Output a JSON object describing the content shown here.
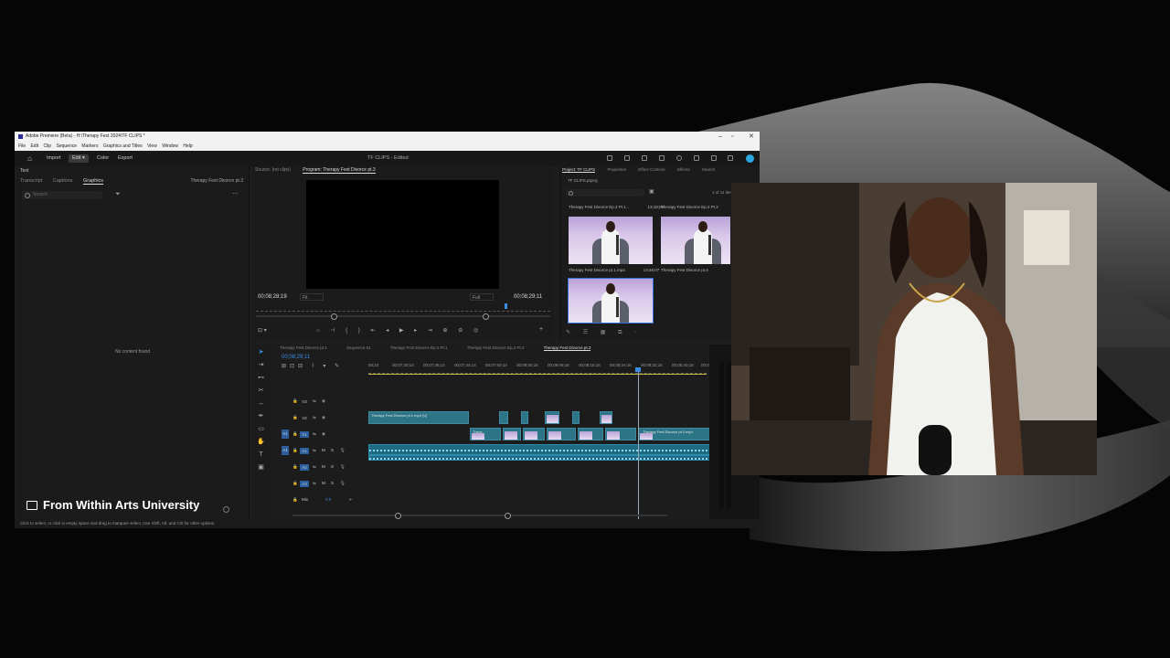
{
  "window": {
    "title": "Adobe Premiere (Beta) - H:\\Therapy Fest 2024\\TF CLIPS *",
    "controls": {
      "minimize": "–",
      "maximize": "▫",
      "close": "✕"
    }
  },
  "menu": [
    "File",
    "Edit",
    "Clip",
    "Sequence",
    "Markers",
    "Graphics and Titles",
    "View",
    "Window",
    "Help"
  ],
  "workspace": {
    "home_icon": "home-icon",
    "import": "Import",
    "edit": "Edit",
    "color": "Color",
    "export": "Export",
    "center_title": "TF CLIPS - Edited"
  },
  "text_panel": {
    "header": "Text",
    "tabs": [
      "Transcript",
      "Captions",
      "Graphics"
    ],
    "active_tab": "Graphics",
    "sequence": "Therapy Fest Divorce pt.3",
    "search_placeholder": "Search",
    "empty_message": "No content found"
  },
  "monitor": {
    "tabs": [
      "Source: (no clips)",
      "Program: Therapy Fest Divorce pt.3"
    ],
    "timecode_left": "00;08;28;19",
    "fit": "Fit",
    "quality": "Full",
    "timecode_right": "00;08;29;11",
    "controls": "⌂ ⊣ { } ⇤ ◂ ▶ ▸ ⇥ ⊕ ⊖ ◎",
    "add": "+"
  },
  "project": {
    "tabs": [
      "Project: TF CLIPS",
      "Properties",
      "Effect Controls",
      "Effects",
      "Search"
    ],
    "path": "TF CLIPS.prproj",
    "count": "1 of 11 items",
    "items": [
      {
        "name": "Therapy Fest Divorce Ep.2 Pt.1...",
        "dur": "13;18;05"
      },
      {
        "name": "Therapy Fest Divorce Ep.2 Pt.2",
        "dur": "1"
      },
      {
        "name": "Therapy Fest Divorce pt.1.mp4",
        "dur": "13;46;07"
      },
      {
        "name": "Therapy Fest Divorce pt.4",
        "dur": ""
      }
    ],
    "bottom_icons": "✎ ☰ ▦ ⧉ ◦"
  },
  "timeline": {
    "tabs": [
      "Therapy Fest Divorce pt.1",
      "Sequence 01",
      "Therapy Fest Divorce Ep.2 Pt.1",
      "Therapy Fest Divorce Ep.2 Pt.2",
      "Therapy Fest Divorce pt.3"
    ],
    "timecode": "00;08;29;11",
    "ruler": [
      "00;24",
      "00;07;20;14",
      "00;07;36;14",
      "00;07;44;14",
      "00;07;52;14",
      "00;08;00;16",
      "00;08;08;16",
      "00;08;16;16",
      "00;08;24;16",
      "00;08;32;16",
      "00;08;40;16",
      "00;08;4"
    ],
    "tracks": [
      "V3",
      "V2",
      "V1",
      "A1",
      "A2",
      "A3",
      "Mix"
    ],
    "mix_value": "0.0",
    "clip_v2_label": "Therapy Fest Divorce pt.1.mp4 [V]",
    "clip_v1_label": "Thera",
    "clip_v1_right_label": "Therapy Fest Divorce pt.1.mp4"
  },
  "status": "Click to select, or click in empty space and drag to marquee select. Use Shift, Alt, and Ctrl for other options.",
  "watermark": "From Within Arts University"
}
